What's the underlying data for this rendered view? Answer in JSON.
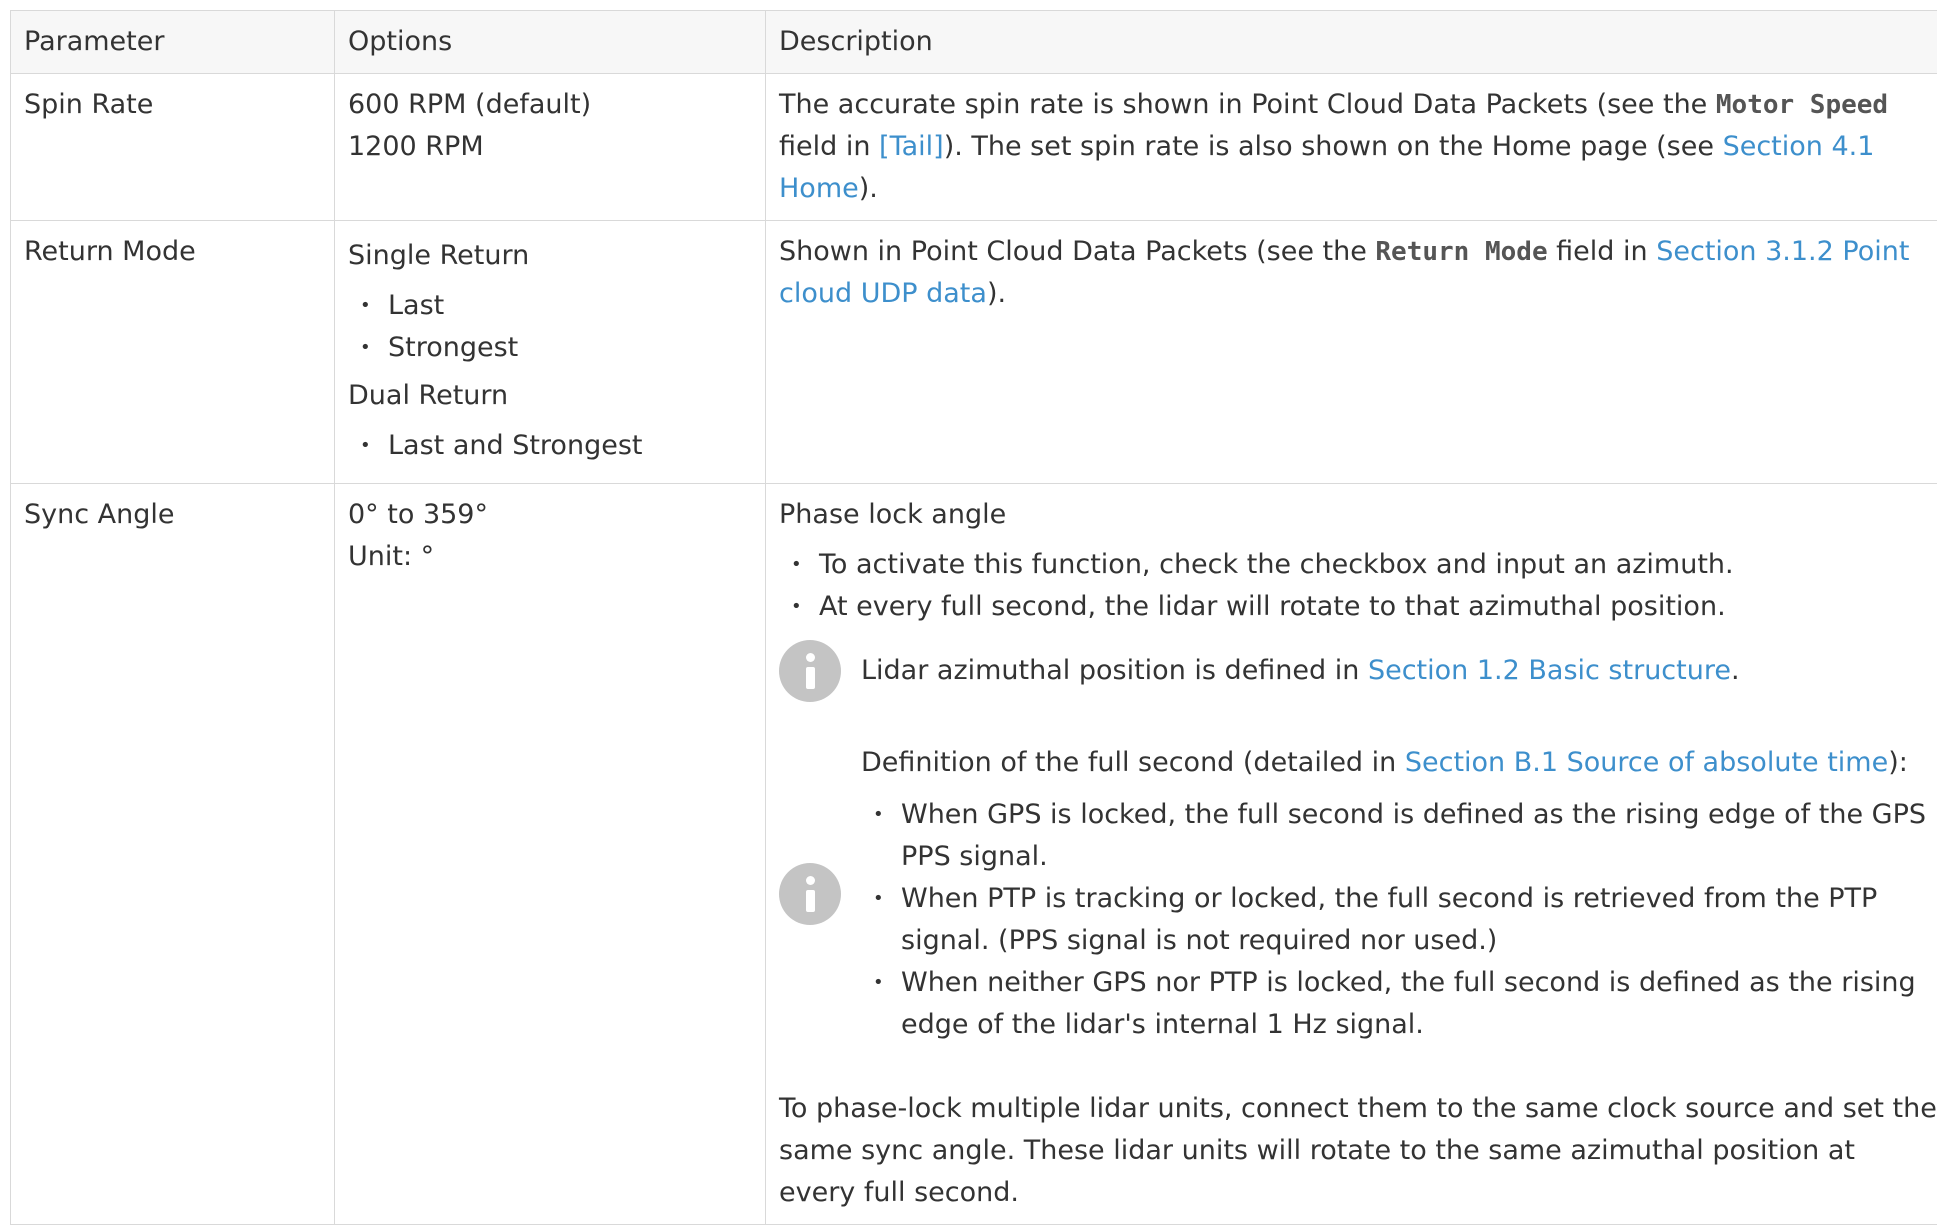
{
  "headers": [
    "Parameter",
    "Options",
    "Description"
  ],
  "rows": {
    "spin": {
      "parameter": "Spin Rate",
      "options": [
        "600 RPM (default)",
        "1200 RPM"
      ],
      "desc": {
        "t1": "The accurate spin rate is shown in Point Cloud Data Packets (see the ",
        "code": "Motor Speed",
        "t2": " field in ",
        "link1": "[Tail]",
        "t3": "). The set spin rate is also shown on the Home page (see ",
        "link2": "Section 4.1 Home",
        "t4": ")."
      }
    },
    "return": {
      "parameter": "Return Mode",
      "group1": "Single Return",
      "group1_items": [
        "Last",
        "Strongest"
      ],
      "group2": "Dual Return",
      "group2_items": [
        "Last and Strongest"
      ],
      "desc": {
        "t1": "Shown in Point Cloud Data Packets (see the ",
        "code": "Return Mode",
        "t2": " field in ",
        "link": "Section 3.1.2 Point cloud UDP data",
        "t3": ")."
      }
    },
    "sync": {
      "parameter": "Sync Angle",
      "options": [
        "0° to 359°",
        "Unit: °"
      ],
      "desc": {
        "title": "Phase lock angle",
        "bullets": [
          "To activate this function, check the checkbox and input an azimuth.",
          "At every full second, the lidar will rotate to that azimuthal position."
        ],
        "note1": {
          "t1": "Lidar azimuthal position is defined in ",
          "link": "Section 1.2 Basic structure",
          "t2": "."
        },
        "note2": {
          "t1": "Definition of the full second (detailed in ",
          "link": "Section B.1 Source of absolute time",
          "t2": "):",
          "items": [
            "When GPS is locked, the full second is defined as the rising edge of the GPS PPS signal.",
            "When PTP is tracking or locked, the full second is retrieved from the PTP signal. (PPS signal is not required nor used.)",
            "When neither GPS nor PTP is locked, the full second is defined as the rising edge of the lidar's internal 1 Hz signal."
          ]
        },
        "tail": "To phase-lock multiple lidar units, connect them to the same clock source and set the same sync angle. These lidar units will rotate to the same azimuthal position at every full second."
      }
    }
  },
  "icons": {
    "note_icon": "info-icon",
    "note_icon_color": "#c4c4c4"
  },
  "colors": {
    "link": "#3d8fcc",
    "border": "#d9d9d9",
    "header_bg": "#f7f7f7"
  }
}
